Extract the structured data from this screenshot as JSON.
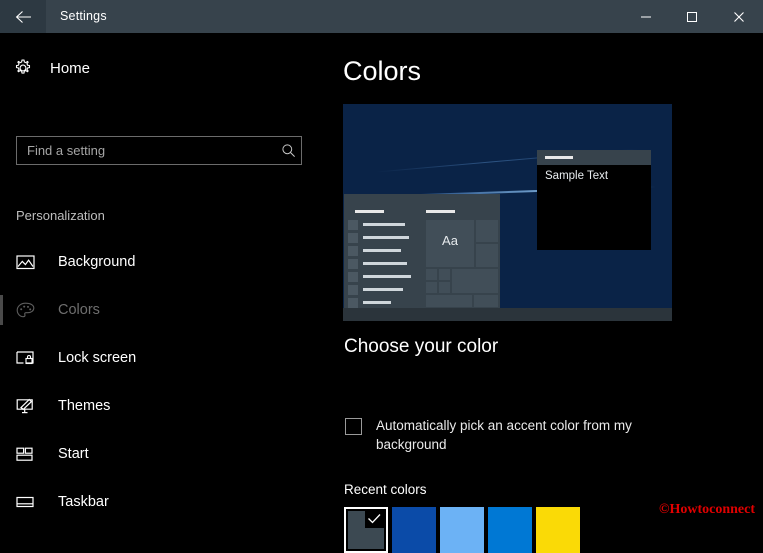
{
  "window": {
    "title": "Settings",
    "back_icon": "back-arrow-icon",
    "minimize_label": "—",
    "maximize_label": "□",
    "close_label": "✕",
    "titlebar_color": "#37434c"
  },
  "sidebar": {
    "home_label": "Home",
    "home_icon": "gear-icon",
    "search": {
      "placeholder": "Find a setting",
      "value": "",
      "icon": "search-icon"
    },
    "section_header": "Personalization",
    "items": [
      {
        "label": "Background",
        "icon": "picture-icon",
        "selected": false
      },
      {
        "label": "Colors",
        "icon": "palette-icon",
        "selected": true
      },
      {
        "label": "Lock screen",
        "icon": "lock-screen-icon",
        "selected": false
      },
      {
        "label": "Themes",
        "icon": "themes-icon",
        "selected": false
      },
      {
        "label": "Start",
        "icon": "start-tiles-icon",
        "selected": false
      },
      {
        "label": "Taskbar",
        "icon": "taskbar-icon",
        "selected": false
      }
    ]
  },
  "main": {
    "page_title": "Colors",
    "preview": {
      "tile_text": "Aa",
      "sample_window_text": "Sample Text"
    },
    "choose_color_title": "Choose your color",
    "auto_accent": {
      "label": "Automatically pick an accent color from my background",
      "checked": false
    },
    "recent_colors_label": "Recent colors",
    "recent_colors": [
      {
        "name": "dark-slate",
        "hex": "#3c4952",
        "selected": true
      },
      {
        "name": "navy-blue",
        "hex": "#0b4ba8",
        "selected": false
      },
      {
        "name": "light-blue",
        "hex": "#6cb2f5",
        "selected": false
      },
      {
        "name": "medium-blue",
        "hex": "#0078d4",
        "selected": false
      },
      {
        "name": "yellow",
        "hex": "#fada06",
        "selected": false
      }
    ]
  },
  "watermark": "©Howtoconnect"
}
